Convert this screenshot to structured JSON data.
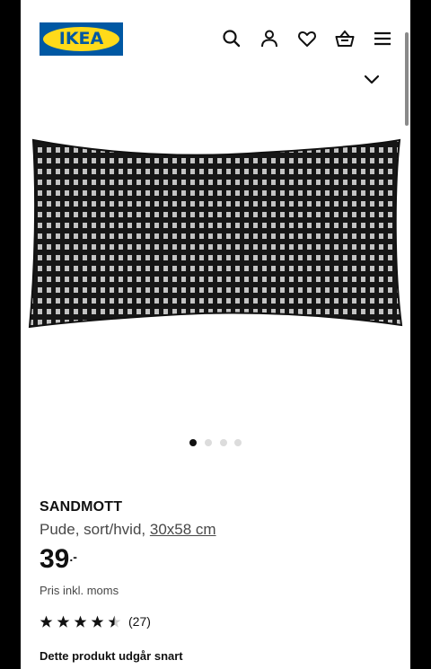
{
  "header": {
    "logo_text": "IKEA",
    "icons": [
      "search-icon",
      "profile-icon",
      "heart-icon",
      "basket-icon",
      "menu-icon"
    ],
    "brand_colors": {
      "blue": "#0058A3",
      "yellow": "#FFDA1A"
    }
  },
  "gallery": {
    "image": "black-white-checkered-cushion",
    "dots_count": 4,
    "active_index": 0
  },
  "product": {
    "name": "SANDMOTT",
    "description": "Pude, sort/hvid,",
    "size": "30x58 cm",
    "price_integer": "39",
    "price_suffix": ".-",
    "vat_note": "Pris inkl. moms",
    "rating": 4.5,
    "reviews": "(27)",
    "availability": "Dette produkt udgår snart"
  }
}
